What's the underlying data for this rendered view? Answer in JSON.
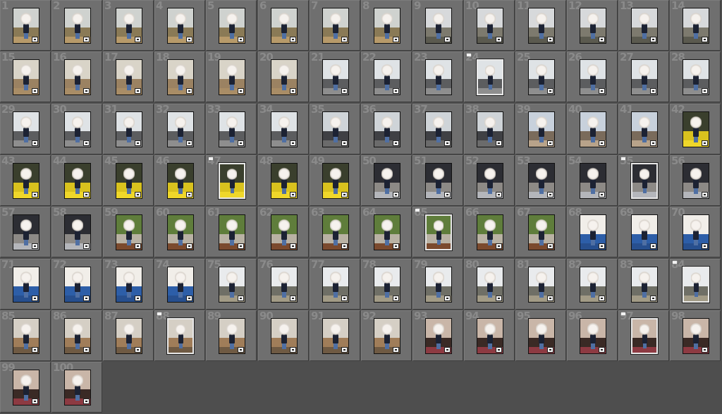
{
  "app": {
    "view": "Library Grid",
    "background": "#4e4e4e",
    "cell_color": "#6f6f6f",
    "label_color": "#8a8a8a"
  },
  "grid": {
    "columns": 14,
    "cells": [
      {
        "n": "1",
        "scene": "park",
        "flag": false,
        "badge": true
      },
      {
        "n": "2",
        "scene": "park",
        "flag": false,
        "badge": true
      },
      {
        "n": "3",
        "scene": "park",
        "flag": false,
        "badge": true
      },
      {
        "n": "4",
        "scene": "park",
        "flag": false,
        "badge": true
      },
      {
        "n": "5",
        "scene": "park",
        "flag": false,
        "badge": true
      },
      {
        "n": "6",
        "scene": "park",
        "flag": false,
        "badge": true
      },
      {
        "n": "7",
        "scene": "park",
        "flag": false,
        "badge": true
      },
      {
        "n": "8",
        "scene": "park",
        "flag": false,
        "badge": true
      },
      {
        "n": "9",
        "scene": "street-tree",
        "flag": false,
        "badge": true
      },
      {
        "n": "10",
        "scene": "street-tree",
        "flag": false,
        "badge": true
      },
      {
        "n": "11",
        "scene": "street-tree",
        "flag": false,
        "badge": true
      },
      {
        "n": "12",
        "scene": "street-tree",
        "flag": false,
        "badge": true
      },
      {
        "n": "13",
        "scene": "street-tree",
        "flag": false,
        "badge": true
      },
      {
        "n": "14",
        "scene": "street-tree",
        "flag": false,
        "badge": true
      },
      {
        "n": "15",
        "scene": "sidewalk",
        "flag": false,
        "badge": true
      },
      {
        "n": "16",
        "scene": "sidewalk",
        "flag": false,
        "badge": true
      },
      {
        "n": "17",
        "scene": "sidewalk",
        "flag": false,
        "badge": true
      },
      {
        "n": "18",
        "scene": "sidewalk",
        "flag": false,
        "badge": true
      },
      {
        "n": "19",
        "scene": "sidewalk",
        "flag": false,
        "badge": true
      },
      {
        "n": "20",
        "scene": "sidewalk",
        "flag": false,
        "badge": true
      },
      {
        "n": "21",
        "scene": "road",
        "flag": false,
        "badge": true
      },
      {
        "n": "22",
        "scene": "road",
        "flag": false,
        "badge": true
      },
      {
        "n": "23",
        "scene": "road",
        "flag": false,
        "badge": false
      },
      {
        "n": "24",
        "scene": "road",
        "flag": true,
        "badge": false
      },
      {
        "n": "25",
        "scene": "road",
        "flag": false,
        "badge": true
      },
      {
        "n": "26",
        "scene": "road",
        "flag": false,
        "badge": true
      },
      {
        "n": "27",
        "scene": "road",
        "flag": false,
        "badge": true
      },
      {
        "n": "28",
        "scene": "road",
        "flag": false,
        "badge": true
      },
      {
        "n": "29",
        "scene": "road",
        "flag": false,
        "badge": true
      },
      {
        "n": "30",
        "scene": "road",
        "flag": false,
        "badge": true
      },
      {
        "n": "31",
        "scene": "road",
        "flag": false,
        "badge": true
      },
      {
        "n": "32",
        "scene": "road",
        "flag": false,
        "badge": true
      },
      {
        "n": "33",
        "scene": "road",
        "flag": false,
        "badge": true
      },
      {
        "n": "34",
        "scene": "road",
        "flag": false,
        "badge": true
      },
      {
        "n": "35",
        "scene": "road-dark",
        "flag": false,
        "badge": true
      },
      {
        "n": "36",
        "scene": "road-dark",
        "flag": false,
        "badge": true
      },
      {
        "n": "37",
        "scene": "road-dark",
        "flag": false,
        "badge": true
      },
      {
        "n": "38",
        "scene": "road-dark",
        "flag": false,
        "badge": true
      },
      {
        "n": "39",
        "scene": "houses",
        "flag": false,
        "badge": true
      },
      {
        "n": "40",
        "scene": "houses",
        "flag": false,
        "badge": true
      },
      {
        "n": "41",
        "scene": "houses",
        "flag": false,
        "badge": true
      },
      {
        "n": "42",
        "scene": "flowers",
        "flag": false,
        "badge": true
      },
      {
        "n": "43",
        "scene": "flowers",
        "flag": false,
        "badge": true
      },
      {
        "n": "44",
        "scene": "flowers",
        "flag": false,
        "badge": true
      },
      {
        "n": "45",
        "scene": "flowers",
        "flag": false,
        "badge": true
      },
      {
        "n": "46",
        "scene": "flowers",
        "flag": false,
        "badge": true
      },
      {
        "n": "47",
        "scene": "flowers",
        "flag": true,
        "badge": false
      },
      {
        "n": "48",
        "scene": "flowers",
        "flag": false,
        "badge": true
      },
      {
        "n": "49",
        "scene": "flowers",
        "flag": false,
        "badge": true
      },
      {
        "n": "50",
        "scene": "shop",
        "flag": false,
        "badge": true
      },
      {
        "n": "51",
        "scene": "shop",
        "flag": false,
        "badge": true
      },
      {
        "n": "52",
        "scene": "shop",
        "flag": false,
        "badge": true
      },
      {
        "n": "53",
        "scene": "shop",
        "flag": false,
        "badge": true
      },
      {
        "n": "54",
        "scene": "shop",
        "flag": false,
        "badge": true
      },
      {
        "n": "55",
        "scene": "shop",
        "flag": true,
        "badge": false
      },
      {
        "n": "56",
        "scene": "shop",
        "flag": false,
        "badge": true
      },
      {
        "n": "57",
        "scene": "shop",
        "flag": false,
        "badge": true
      },
      {
        "n": "58",
        "scene": "shop",
        "flag": false,
        "badge": true
      },
      {
        "n": "59",
        "scene": "bench",
        "flag": false,
        "badge": true
      },
      {
        "n": "60",
        "scene": "bench",
        "flag": false,
        "badge": true
      },
      {
        "n": "61",
        "scene": "bench",
        "flag": false,
        "badge": true
      },
      {
        "n": "62",
        "scene": "bench",
        "flag": false,
        "badge": true
      },
      {
        "n": "63",
        "scene": "bench",
        "flag": false,
        "badge": true
      },
      {
        "n": "64",
        "scene": "bench",
        "flag": false,
        "badge": true
      },
      {
        "n": "65",
        "scene": "bench",
        "flag": true,
        "badge": false
      },
      {
        "n": "66",
        "scene": "bench",
        "flag": false,
        "badge": true
      },
      {
        "n": "67",
        "scene": "bench",
        "flag": false,
        "badge": true
      },
      {
        "n": "68",
        "scene": "slide",
        "flag": false,
        "badge": true
      },
      {
        "n": "69",
        "scene": "slide",
        "flag": false,
        "badge": true
      },
      {
        "n": "70",
        "scene": "slide",
        "flag": false,
        "badge": true
      },
      {
        "n": "71",
        "scene": "slide",
        "flag": false,
        "badge": true
      },
      {
        "n": "72",
        "scene": "slide",
        "flag": false,
        "badge": true
      },
      {
        "n": "73",
        "scene": "slide",
        "flag": false,
        "badge": true
      },
      {
        "n": "74",
        "scene": "slide",
        "flag": false,
        "badge": true
      },
      {
        "n": "75",
        "scene": "plaza",
        "flag": false,
        "badge": true
      },
      {
        "n": "76",
        "scene": "plaza",
        "flag": false,
        "badge": true
      },
      {
        "n": "77",
        "scene": "plaza",
        "flag": false,
        "badge": true
      },
      {
        "n": "78",
        "scene": "plaza",
        "flag": false,
        "badge": true
      },
      {
        "n": "79",
        "scene": "plaza",
        "flag": false,
        "badge": true
      },
      {
        "n": "80",
        "scene": "plaza",
        "flag": false,
        "badge": true
      },
      {
        "n": "81",
        "scene": "plaza",
        "flag": false,
        "badge": true
      },
      {
        "n": "82",
        "scene": "plaza",
        "flag": false,
        "badge": true
      },
      {
        "n": "83",
        "scene": "plaza",
        "flag": false,
        "badge": true
      },
      {
        "n": "84",
        "scene": "plaza",
        "flag": true,
        "badge": false
      },
      {
        "n": "85",
        "scene": "path",
        "flag": false,
        "badge": true
      },
      {
        "n": "86",
        "scene": "path",
        "flag": false,
        "badge": true
      },
      {
        "n": "87",
        "scene": "path",
        "flag": false,
        "badge": true
      },
      {
        "n": "88",
        "scene": "path",
        "flag": true,
        "badge": false
      },
      {
        "n": "89",
        "scene": "path",
        "flag": false,
        "badge": true
      },
      {
        "n": "90",
        "scene": "path",
        "flag": false,
        "badge": true
      },
      {
        "n": "91",
        "scene": "path",
        "flag": false,
        "badge": true
      },
      {
        "n": "92",
        "scene": "path",
        "flag": false,
        "badge": true
      },
      {
        "n": "93",
        "scene": "bouquet",
        "flag": false,
        "badge": true
      },
      {
        "n": "94",
        "scene": "bouquet",
        "flag": false,
        "badge": true
      },
      {
        "n": "95",
        "scene": "bouquet",
        "flag": false,
        "badge": true
      },
      {
        "n": "96",
        "scene": "bouquet",
        "flag": false,
        "badge": true
      },
      {
        "n": "97",
        "scene": "bouquet",
        "flag": true,
        "badge": false
      },
      {
        "n": "98",
        "scene": "bouquet",
        "flag": false,
        "badge": true
      },
      {
        "n": "99",
        "scene": "bouquet",
        "flag": false,
        "badge": true
      },
      {
        "n": "100",
        "scene": "bouquet",
        "flag": false,
        "badge": true
      }
    ]
  },
  "scenes": {
    "park": {
      "sky": "#cfd2cf",
      "ground": "#8a7a56",
      "extra": "#b79a6a"
    },
    "street-tree": {
      "sky": "#d7d9db",
      "ground": "#7d7a6e",
      "extra": "#5b5a4f"
    },
    "sidewalk": {
      "sky": "#d9d4c8",
      "ground": "#9b8262",
      "extra": "#a98d66"
    },
    "road": {
      "sky": "#dfe3e6",
      "ground": "#5c5d5f",
      "extra": "#8e8e8e"
    },
    "road-dark": {
      "sky": "#cfd4d8",
      "ground": "#3f4044",
      "extra": "#6b6b6b"
    },
    "houses": {
      "sky": "#c8d1dc",
      "ground": "#7a6b5b",
      "extra": "#b8a38a"
    },
    "flowers": {
      "sky": "#3a3f2d",
      "ground": "#d9c21e",
      "extra": "#efd72a"
    },
    "shop": {
      "sky": "#2c2d33",
      "ground": "#8d8a86",
      "extra": "#b4b6bb"
    },
    "bench": {
      "sky": "#5f7d3b",
      "ground": "#b9b2a4",
      "extra": "#7b4a2e"
    },
    "slide": {
      "sky": "#f1eee9",
      "ground": "#2d5ea8",
      "extra": "#274f8e"
    },
    "plaza": {
      "sky": "#e9ebed",
      "ground": "#6f6f66",
      "extra": "#a29b86"
    },
    "path": {
      "sky": "#d5cfc5",
      "ground": "#a07d59",
      "extra": "#6f5a43"
    },
    "bouquet": {
      "sky": "#c9b6a8",
      "ground": "#3a2a25",
      "extra": "#8d3a42"
    }
  }
}
